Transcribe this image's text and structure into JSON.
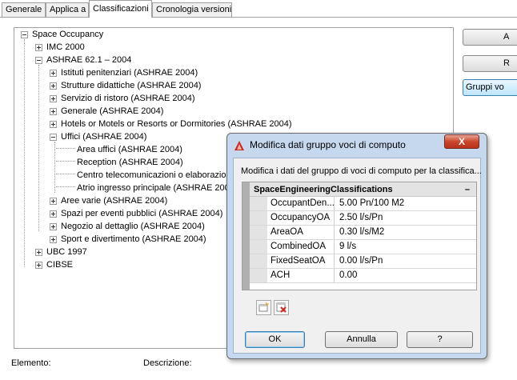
{
  "tabs": [
    {
      "label": "Generale"
    },
    {
      "label": "Applica a"
    },
    {
      "label": "Classificazioni"
    },
    {
      "label": "Cronologia versioni"
    }
  ],
  "tree": {
    "root": "Space Occupancy",
    "imc": "IMC 2000",
    "ashrae": "ASHRAE 62.1 – 2004",
    "items": [
      "Istituti penitenziari (ASHRAE 2004)",
      "Strutture didattiche (ASHRAE 2004)",
      "Servizio di ristoro (ASHRAE 2004)",
      "Generale (ASHRAE 2004)",
      "Hotels or Motels or Resorts or Dormitories (ASHRAE 2004)",
      "Uffici (ASHRAE 2004)"
    ],
    "uffici_children": [
      "Area uffici (ASHRAE 2004)",
      "Reception (ASHRAE 2004)",
      "Centro telecomunicazioni o elaborazion",
      "Atrio ingresso principale (ASHRAE 200"
    ],
    "items_after": [
      "Aree varie (ASHRAE 2004)",
      "Spazi per eventi pubblici (ASHRAE 2004)",
      "Negozio al dettaglio (ASHRAE 2004)",
      "Sport e divertimento (ASHRAE 2004)"
    ],
    "ubc": "UBC 1997",
    "cibse": "CIBSE"
  },
  "side_buttons": [
    "A",
    "R",
    "Gruppi vo"
  ],
  "bottom": {
    "elemento": "Elemento:",
    "descrizione": "Descrizione:"
  },
  "dialog": {
    "title": "Modifica dati gruppo voci di computo",
    "close": "X",
    "description": "Modifica i dati del gruppo di voci di computo per la classifica...",
    "grid_header": "SpaceEngineeringClassifications",
    "grid_toggle": "–",
    "rows": [
      {
        "key": "OccupantDen...",
        "value": "5.00 Pn/100 M2"
      },
      {
        "key": "OccupancyOA",
        "value": "2.50  l/s/Pn"
      },
      {
        "key": "AreaOA",
        "value": "0.30 l/s/M2"
      },
      {
        "key": "CombinedOA",
        "value": "9 l/s"
      },
      {
        "key": "FixedSeatOA",
        "value": "0.00  l/s/Pn"
      },
      {
        "key": "ACH",
        "value": "0.00"
      }
    ],
    "ok": "OK",
    "cancel": "Annulla",
    "help": "?"
  }
}
